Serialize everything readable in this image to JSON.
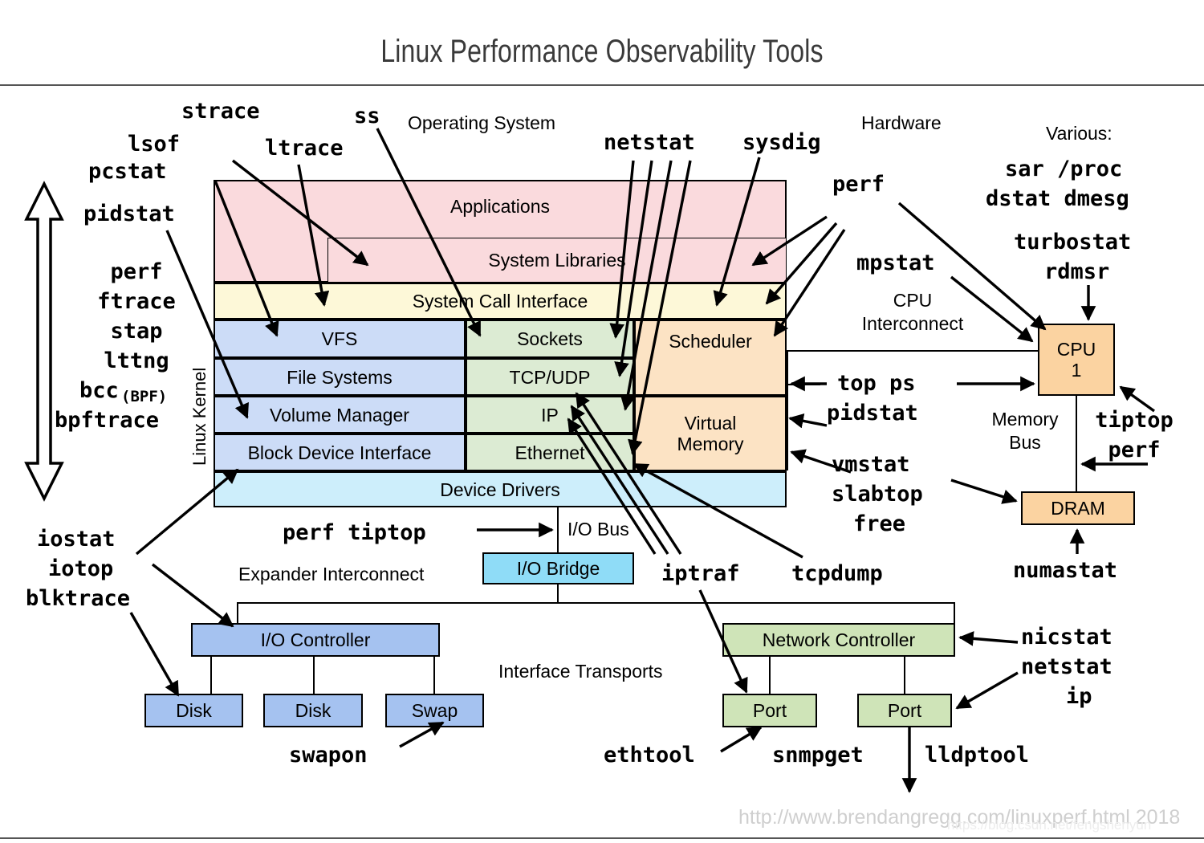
{
  "title": "Linux Performance Observability Tools",
  "footer": {
    "url": "http://www.brendangregg.com/linuxperf.html 2018",
    "watermark": "https://blog.csdn.net/fengshenyun"
  },
  "section_labels": {
    "operating_system": "Operating System",
    "hardware": "Hardware",
    "various": "Various:",
    "linux_kernel": "Linux Kernel",
    "cpu_interconnect": "CPU\nInterconnect",
    "memory_bus": "Memory\nBus",
    "io_bus": "I/O Bus",
    "expander_interconnect": "Expander Interconnect",
    "interface_transports": "Interface Transports"
  },
  "stack": {
    "applications": "Applications",
    "system_libraries": "System Libraries",
    "system_call_interface": "System Call Interface",
    "vfs": "VFS",
    "file_systems": "File Systems",
    "volume_manager": "Volume Manager",
    "block_device_interface": "Block Device Interface",
    "sockets": "Sockets",
    "tcp_udp": "TCP/UDP",
    "ip": "IP",
    "ethernet": "Ethernet",
    "scheduler": "Scheduler",
    "virtual_memory": "Virtual\nMemory",
    "device_drivers": "Device Drivers"
  },
  "hardware": {
    "cpu": "CPU\n1",
    "dram": "DRAM",
    "io_bridge": "I/O Bridge",
    "io_controller": "I/O Controller",
    "disk1": "Disk",
    "disk2": "Disk",
    "swap": "Swap",
    "network_controller": "Network Controller",
    "port1": "Port",
    "port2": "Port"
  },
  "tools": {
    "strace": "strace",
    "ss": "ss",
    "lsof": "lsof",
    "pcstat": "pcstat",
    "ltrace": "ltrace",
    "pidstat_left": "pidstat",
    "netstat_top": "netstat",
    "sysdig": "sysdig",
    "perf_hw": "perf",
    "mpstat": "mpstat",
    "sar_proc": "sar /proc",
    "dstat_dmesg": "dstat dmesg",
    "turbostat": "turbostat",
    "rdmsr": "rdmsr",
    "kernel_block": "perf\nftrace\nstap\nlttng",
    "bcc": "bcc",
    "bcc_suffix": "(BPF)",
    "bpftrace": "bpftrace",
    "top_ps": "top ps",
    "pidstat_right": "pidstat",
    "tiptop_perf": "tiptop\nperf",
    "vmstat": "vmstat",
    "slabtop": "slabtop",
    "free": "free",
    "numastat": "numastat",
    "iostat": "iostat",
    "iotop": "iotop",
    "blktrace": "blktrace",
    "perf_tiptop": "perf tiptop",
    "iptraf": "iptraf",
    "tcpdump": "tcpdump",
    "swapon": "swapon",
    "ethtool": "ethtool",
    "snmpget": "snmpget",
    "lldptool": "lldptool",
    "nicstat": "nicstat",
    "netstat_right": "netstat",
    "ip": "ip"
  },
  "colors": {
    "pink": "#fadadd",
    "yellow": "#fdf8d8",
    "blue": "#ccdcf7",
    "green": "#dcebd3",
    "orange": "#fce3c4",
    "cyan": "#cdeefb",
    "hw_blue": "#a5c2f0",
    "hw_green": "#cfe4b8",
    "hw_orange": "#fbd3a1",
    "hw_cyan": "#8fdcf7",
    "stroke": "#000000",
    "title": "#3a3a3a",
    "footer": "#cfcfcf"
  },
  "icons": {
    "up_arrow": "up-arrow-icon",
    "down_arrow": "down-arrow-icon"
  }
}
